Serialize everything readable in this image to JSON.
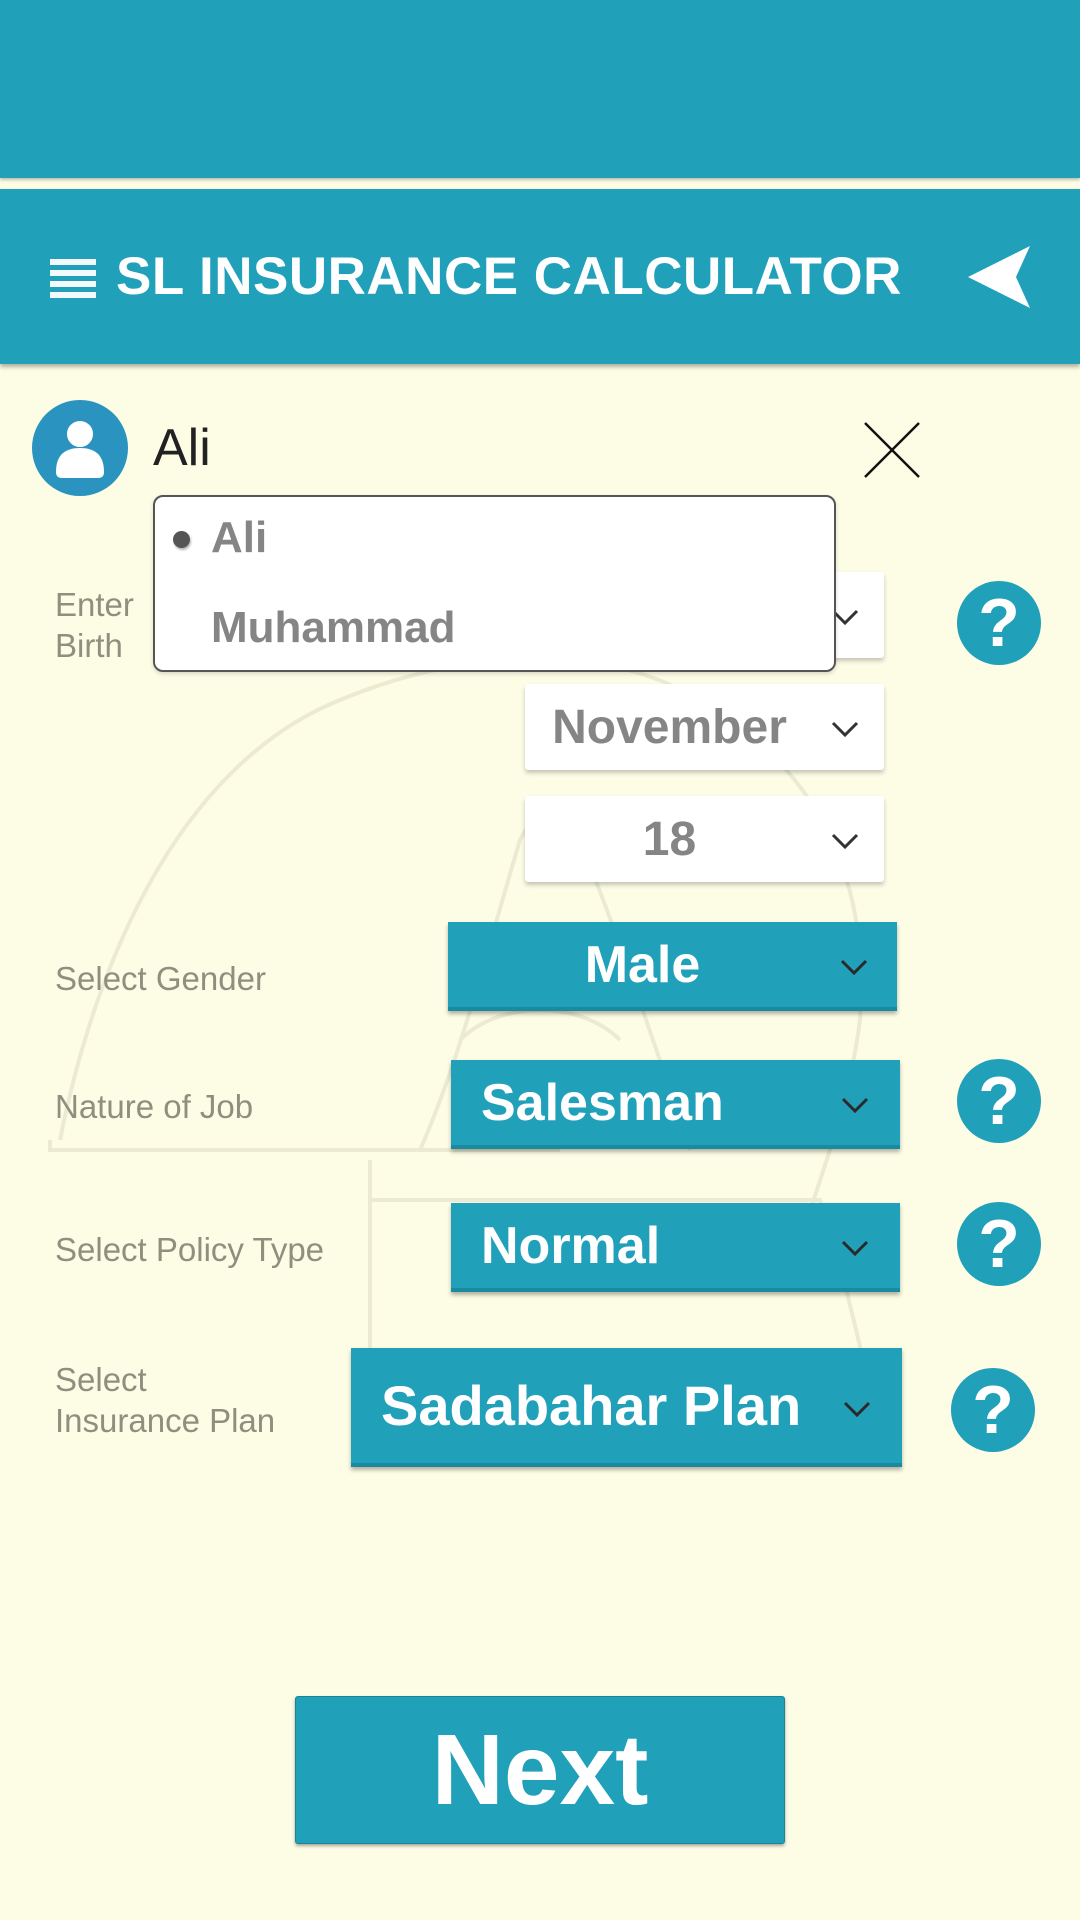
{
  "app": {
    "title": "SL INSURANCE CALCULATOR",
    "accent_color": "#21a0ba",
    "background_color": "#fdfde6"
  },
  "header": {
    "menu_icon": "hamburger-menu-icon",
    "back_icon": "back-arrow-icon"
  },
  "profile": {
    "avatar_icon": "user-avatar-icon",
    "name": "Ali",
    "close_icon": "close-icon"
  },
  "profile_popup": {
    "items": [
      {
        "label": "Ali",
        "selected": true
      },
      {
        "label": "Muhammad",
        "selected": false
      }
    ]
  },
  "form": {
    "dob": {
      "label_line1": "Enter",
      "label_line2": "Birth",
      "month": "November",
      "day": "18",
      "help_icon": "help-icon"
    },
    "gender": {
      "label": "Select Gender",
      "value": "Male"
    },
    "job": {
      "label": "Nature of Job",
      "value": "Salesman",
      "help_icon": "help-icon"
    },
    "policy": {
      "label": "Select Policy Type",
      "value": "Normal",
      "help_icon": "help-icon"
    },
    "plan": {
      "label_line1": "Select",
      "label_line2": "Insurance Plan",
      "value": "Sadabahar Plan",
      "help_icon": "help-icon"
    }
  },
  "help_glyph": "?",
  "next_button": {
    "label": "Next"
  }
}
